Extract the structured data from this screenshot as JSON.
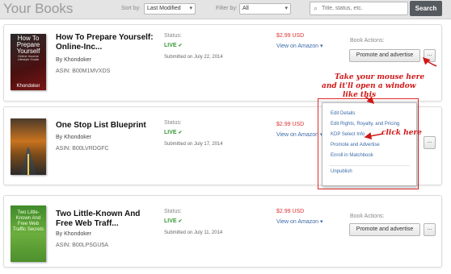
{
  "header": {
    "title": "Your Books",
    "sort_label": "Sort by:",
    "sort_value": "Last Modified",
    "filter_label": "Filter by:",
    "filter_value": "All",
    "search_placeholder": "Title, status, etc.",
    "search_button": "Search"
  },
  "books": [
    {
      "title": "How To Prepare Yourself: Online-Inc...",
      "author": "By Khondoker",
      "asin": "ASIN: B00M1MVXDS",
      "status_label": "Status:",
      "status": "LIVE",
      "submitted": "Submitted on July 22, 2014",
      "price": "$2.99 USD",
      "view_link": "View on Amazon",
      "actions_label": "Book Actions:",
      "promote": "Promote and advertise",
      "more": "...",
      "cover": {
        "line1": "How To",
        "line2": "Prepare",
        "line3": "Yourself",
        "small": "Online Income Lifestyle Guide",
        "author": "Khondoker"
      }
    },
    {
      "title": "One Stop List Blueprint",
      "author": "By Khondoker",
      "asin": "ASIN: B00LVRDGFC",
      "status_label": "Status:",
      "status": "LIVE",
      "submitted": "Submitted on July 17, 2014",
      "price": "$2.99 USD",
      "view_link": "View on Amazon",
      "more": "..."
    },
    {
      "title": "Two Little-Known And Free Web Traff...",
      "author": "By Khondoker",
      "asin": "ASIN: B00LPSGU5A",
      "status_label": "Status:",
      "status": "LIVE",
      "submitted": "Submitted on July 11, 2014",
      "price": "$2.99 USD",
      "view_link": "View on Amazon",
      "actions_label": "Book Actions:",
      "promote": "Promote and advertise",
      "more": "...",
      "cover": {
        "text": "Two Little-Known And Free Web Traffic Secrets"
      }
    }
  ],
  "dropdown": {
    "items": [
      "Edit Details",
      "Edit Rights, Royalty, and Pricing",
      "KDP Select Info",
      "Promote and Advertise",
      "Enroll in Matchbook",
      "Unpublish"
    ]
  },
  "annotations": {
    "hint1": "Take your mouse here",
    "hint2": "and it'll open a window",
    "hint3": "like this",
    "click_here": "click here"
  },
  "colors": {
    "accent_red": "#d01818",
    "live_green": "#3a9a3a",
    "link_blue": "#3b6aa8",
    "price_red": "#dd3333",
    "search_button": "#565b60"
  }
}
